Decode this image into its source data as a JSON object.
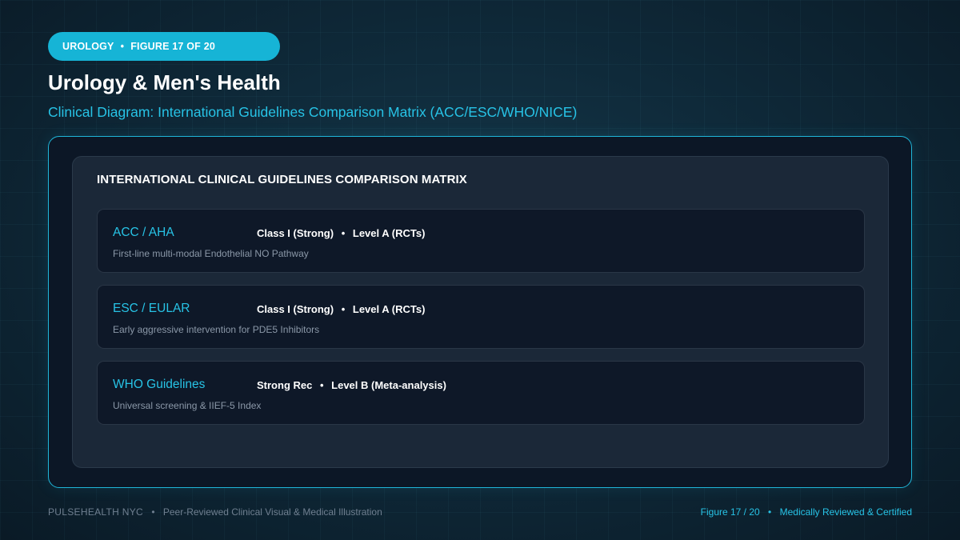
{
  "header": {
    "category": "UROLOGY",
    "figure_label": "FIGURE 17 OF 20",
    "separator": "•",
    "title": "Urology & Men's Health",
    "subtitle": "Clinical Diagram: International Guidelines Comparison Matrix (ACC/ESC/WHO/NICE)"
  },
  "matrix": {
    "title": "INTERNATIONAL CLINICAL GUIDELINES COMPARISON MATRIX",
    "rows": [
      {
        "organization": "ACC / AHA",
        "recommendation": "Class I (Strong)",
        "evidence": "Level A (RCTs)",
        "description": "First-line multi-modal Endothelial NO Pathway"
      },
      {
        "organization": "ESC / EULAR",
        "recommendation": "Class I (Strong)",
        "evidence": "Level A (RCTs)",
        "description": "Early aggressive intervention for PDE5 Inhibitors"
      },
      {
        "organization": "WHO Guidelines",
        "recommendation": "Strong Rec",
        "evidence": "Level B (Meta-analysis)",
        "description": "Universal screening & IIEF-5 Index"
      }
    ]
  },
  "footer": {
    "brand": "PULSEHEALTH NYC",
    "tagline": "Peer-Reviewed Clinical Visual & Medical Illustration",
    "figure_count": "Figure 17 / 20",
    "certification": "Medically Reviewed & Certified"
  },
  "colors": {
    "accent": "#27c3e6",
    "pill": "#16b4d6",
    "background": "#0f2a3a",
    "panel": "#1b2838",
    "row": "#0e1828"
  }
}
